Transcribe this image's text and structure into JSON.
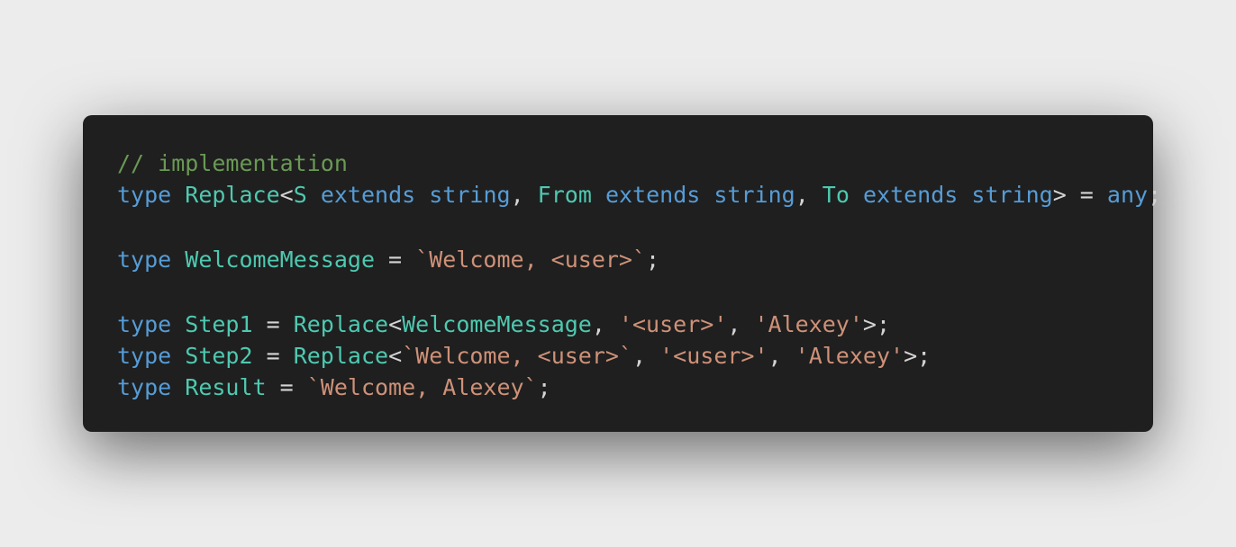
{
  "colors": {
    "background": "#ececec",
    "editor_background": "#1f1f1f",
    "comment": "#6a9955",
    "keyword": "#569cd6",
    "type": "#4ec9b0",
    "string": "#ce9178",
    "punctuation": "#d4d4d4"
  },
  "code": {
    "lines": [
      {
        "tokens": [
          {
            "t": "// implementation",
            "k": "comment"
          }
        ]
      },
      {
        "tokens": [
          {
            "t": "type",
            "k": "keyword"
          },
          {
            "t": " ",
            "k": "punct"
          },
          {
            "t": "Replace",
            "k": "type"
          },
          {
            "t": "<",
            "k": "punct"
          },
          {
            "t": "S",
            "k": "type"
          },
          {
            "t": " ",
            "k": "punct"
          },
          {
            "t": "extends",
            "k": "keyword"
          },
          {
            "t": " ",
            "k": "punct"
          },
          {
            "t": "string",
            "k": "keyword"
          },
          {
            "t": ", ",
            "k": "punct"
          },
          {
            "t": "From",
            "k": "type"
          },
          {
            "t": " ",
            "k": "punct"
          },
          {
            "t": "extends",
            "k": "keyword"
          },
          {
            "t": " ",
            "k": "punct"
          },
          {
            "t": "string",
            "k": "keyword"
          },
          {
            "t": ", ",
            "k": "punct"
          },
          {
            "t": "To",
            "k": "type"
          },
          {
            "t": " ",
            "k": "punct"
          },
          {
            "t": "extends",
            "k": "keyword"
          },
          {
            "t": " ",
            "k": "punct"
          },
          {
            "t": "string",
            "k": "keyword"
          },
          {
            "t": "> = ",
            "k": "punct"
          },
          {
            "t": "any",
            "k": "keyword"
          },
          {
            "t": ";",
            "k": "punct"
          }
        ]
      },
      {
        "tokens": []
      },
      {
        "tokens": [
          {
            "t": "type",
            "k": "keyword"
          },
          {
            "t": " ",
            "k": "punct"
          },
          {
            "t": "WelcomeMessage",
            "k": "type"
          },
          {
            "t": " = ",
            "k": "punct"
          },
          {
            "t": "`Welcome, <user>`",
            "k": "string"
          },
          {
            "t": ";",
            "k": "punct"
          }
        ]
      },
      {
        "tokens": []
      },
      {
        "tokens": [
          {
            "t": "type",
            "k": "keyword"
          },
          {
            "t": " ",
            "k": "punct"
          },
          {
            "t": "Step1",
            "k": "type"
          },
          {
            "t": " = ",
            "k": "punct"
          },
          {
            "t": "Replace",
            "k": "type"
          },
          {
            "t": "<",
            "k": "punct"
          },
          {
            "t": "WelcomeMessage",
            "k": "type"
          },
          {
            "t": ", ",
            "k": "punct"
          },
          {
            "t": "'<user>'",
            "k": "string"
          },
          {
            "t": ", ",
            "k": "punct"
          },
          {
            "t": "'Alexey'",
            "k": "string"
          },
          {
            "t": ">;",
            "k": "punct"
          }
        ]
      },
      {
        "tokens": [
          {
            "t": "type",
            "k": "keyword"
          },
          {
            "t": " ",
            "k": "punct"
          },
          {
            "t": "Step2",
            "k": "type"
          },
          {
            "t": " = ",
            "k": "punct"
          },
          {
            "t": "Replace",
            "k": "type"
          },
          {
            "t": "<",
            "k": "punct"
          },
          {
            "t": "`Welcome, <user>`",
            "k": "string"
          },
          {
            "t": ", ",
            "k": "punct"
          },
          {
            "t": "'<user>'",
            "k": "string"
          },
          {
            "t": ", ",
            "k": "punct"
          },
          {
            "t": "'Alexey'",
            "k": "string"
          },
          {
            "t": ">;",
            "k": "punct"
          }
        ]
      },
      {
        "tokens": [
          {
            "t": "type",
            "k": "keyword"
          },
          {
            "t": " ",
            "k": "punct"
          },
          {
            "t": "Result",
            "k": "type"
          },
          {
            "t": " = ",
            "k": "punct"
          },
          {
            "t": "`Welcome, Alexey`",
            "k": "string"
          },
          {
            "t": ";",
            "k": "punct"
          }
        ]
      }
    ]
  }
}
